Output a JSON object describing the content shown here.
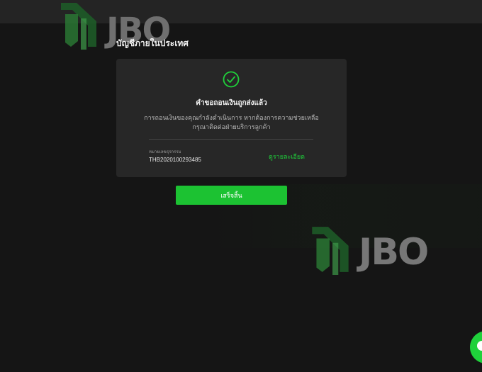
{
  "brand": {
    "logo_text": "JBO",
    "accent_color": "#1cc232"
  },
  "page": {
    "title": "บัญชีภายในประเทศ"
  },
  "card": {
    "status_icon": "check-circle-icon",
    "title": "คำขอถอนเงินถูกส่งแล้ว",
    "description_line1": "การถอนเงินของคุณกำลังดำเนินการ หากต้องการความช่วยเหลือ",
    "description_line2": "กรุณาติดต่อฝ่ายบริการลูกค้า",
    "transaction_label": "หมายเลขธุรกรรม",
    "transaction_number": "THB2020100293485",
    "detail_link": "ดูรายละเอียด"
  },
  "actions": {
    "done_label": "เสร็จสิ้น"
  },
  "chat": {
    "icon": "chat-icon",
    "color": "#1fd13b"
  }
}
